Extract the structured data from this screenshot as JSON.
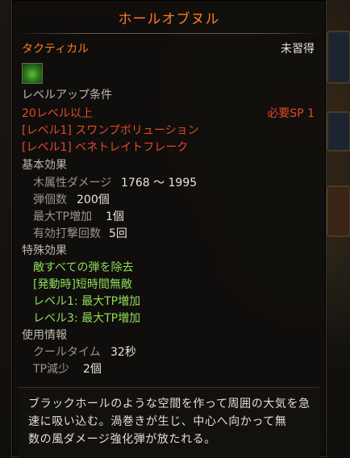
{
  "skill": {
    "name": "ホールオブヌル",
    "type": "タクティカル",
    "status": "未習得",
    "icon": "swamp-vortex-icon"
  },
  "requirements": {
    "header": "レベルアップ条件",
    "level": "20レベル以上",
    "sp": "必要SP 1",
    "prereq": [
      "[レベル1] スワンプボリューション",
      "[レベル1] ベネトレイトフレーク"
    ]
  },
  "basic": {
    "header": "基本効果",
    "stats": [
      {
        "label": "木属性ダメージ",
        "value": "1768 ～ 1995"
      },
      {
        "label": "弾個数",
        "value": "200個"
      },
      {
        "label": "最大TP増加",
        "value": "1個"
      },
      {
        "label": "有効打撃回数",
        "value": "5回"
      }
    ]
  },
  "special": {
    "header": "特殊効果",
    "items": [
      "敵すべての弾を除去",
      "[発動時]短時間無敵",
      "レベル1: 最大TP増加",
      "レベル3: 最大TP増加"
    ]
  },
  "usage": {
    "header": "使用情報",
    "stats": [
      {
        "label": "クールタイム",
        "value": "32秒"
      },
      {
        "label": "TP減少",
        "value": "2個"
      }
    ]
  },
  "description": {
    "lines": [
      "ブラックホールのような空間を作って周囲の大気を急",
      "速に吸い込む。渦巻きが生じ、中心へ向かって無",
      "数の風ダメージ強化弾が放たれる。"
    ]
  },
  "colors": {
    "title": "#ff7a22",
    "required": "#e24a2a",
    "effect": "#8fdc5a"
  }
}
